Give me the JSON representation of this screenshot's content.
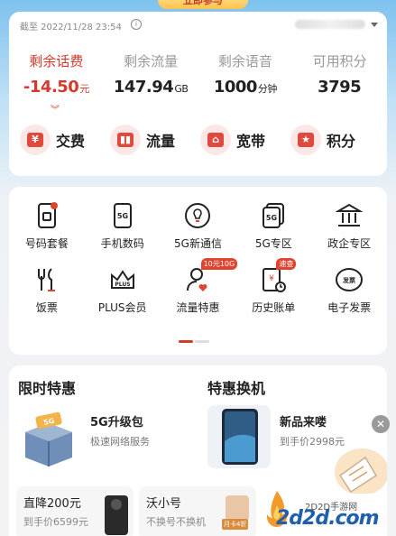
{
  "banner": {
    "label": "立即参与"
  },
  "balance": {
    "asof": "截至 2022/11/28 23:54",
    "stats": [
      {
        "label": "剩余话费",
        "value": "-14.50",
        "unit": "元"
      },
      {
        "label": "剩余流量",
        "value": "147.94",
        "unit": "GB"
      },
      {
        "label": "剩余语音",
        "value": "1000",
        "unit": "分钟"
      },
      {
        "label": "可用积分",
        "value": "3795",
        "unit": ""
      }
    ],
    "actions": [
      {
        "label": "交费",
        "glyph": "¥"
      },
      {
        "label": "流量",
        "glyph": "▮▮"
      },
      {
        "label": "宽带",
        "glyph": "⌂"
      },
      {
        "label": "积分",
        "glyph": "★"
      }
    ]
  },
  "services": {
    "items": [
      {
        "label": "号码套餐",
        "icon": "sim-card-icon",
        "badge": ""
      },
      {
        "label": "手机数码",
        "icon": "phone-5g-icon",
        "badge": ""
      },
      {
        "label": "5G新通信",
        "icon": "lightbulb-icon",
        "badge": ""
      },
      {
        "label": "5G专区",
        "icon": "5g-cards-icon",
        "badge": ""
      },
      {
        "label": "政企专区",
        "icon": "bank-icon",
        "badge": ""
      },
      {
        "label": "饭票",
        "icon": "cutlery-icon",
        "badge": ""
      },
      {
        "label": "PLUS会员",
        "icon": "crown-plus-icon",
        "badge": ""
      },
      {
        "label": "流量特惠",
        "icon": "user-heart-icon",
        "badge": "10元10G"
      },
      {
        "label": "历史账单",
        "icon": "bill-clock-icon",
        "badge": "速查"
      },
      {
        "label": "电子发票",
        "icon": "invoice-icon",
        "badge": ""
      }
    ]
  },
  "deals": {
    "limited_title": "限时特惠",
    "trade_title": "特惠换机",
    "pkg": {
      "title": "5G升级包",
      "sub": "极速网络服务",
      "tag": "5G"
    },
    "newphone": {
      "title": "新品来喽",
      "sub": "到手价2998元"
    },
    "cards": [
      {
        "title": "直降200元",
        "sub": "到手价6599元"
      },
      {
        "title": "沃小号",
        "sub": "不换号不换机",
        "tag": "月卡4折"
      }
    ]
  },
  "watermark": {
    "top": "2D2D手游网",
    "main": "2d2d.com"
  },
  "colors": {
    "accent": "#d53a2e",
    "header": "#7ec2ee"
  }
}
